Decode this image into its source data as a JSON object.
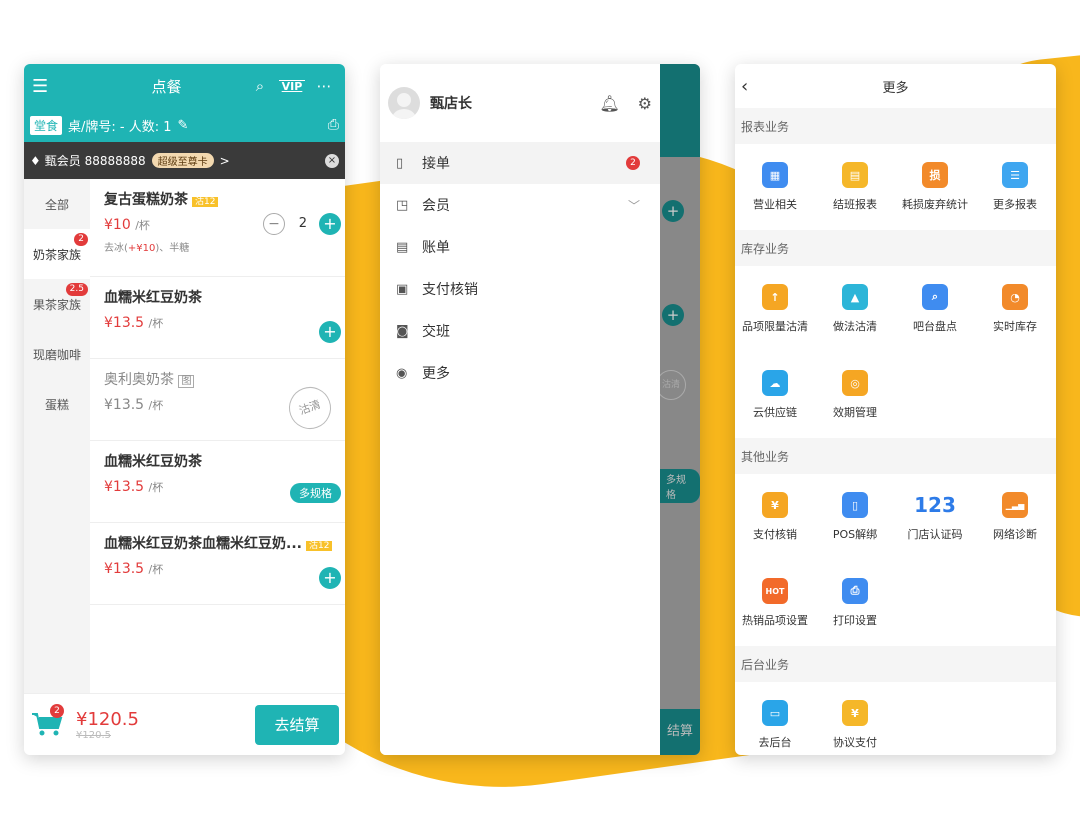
{
  "colors": {
    "teal": "#1fb4b4",
    "red": "#e23b3b",
    "yellow": "#f8b71c"
  },
  "ordering": {
    "header": {
      "menu_icon": "menu-icon",
      "title": "点餐",
      "search_icon": "search-icon",
      "vip_label": "VIP",
      "more_icon": "more-icon"
    },
    "sub": {
      "mode_tag": "堂食",
      "table_info": "桌/牌号: - 人数: 1",
      "edit_icon": "edit-icon",
      "print_icon": "print-icon"
    },
    "member": {
      "text": "甄会员 88888888",
      "card": "超级至尊卡",
      "chevron": ">",
      "close": "×"
    },
    "categories": [
      {
        "label": "全部",
        "badge": ""
      },
      {
        "label": "奶茶家族",
        "badge": "2"
      },
      {
        "label": "果茶家族",
        "badge": "2.5"
      },
      {
        "label": "现磨咖啡",
        "badge": ""
      },
      {
        "label": "蛋糕",
        "badge": ""
      }
    ],
    "items": [
      {
        "name": "复古蛋糕奶茶",
        "tag": "沽12",
        "price": "¥10",
        "unit": "/杯",
        "note_a": "去冰(",
        "note_red": "+¥10",
        "note_b": ")、半糖",
        "qty": "2"
      },
      {
        "name": "血糯米红豆奶茶",
        "price": "¥13.5",
        "unit": "/杯"
      },
      {
        "name": "奥利奥奶茶",
        "badge": "图",
        "price": "¥13.5",
        "unit": "/杯",
        "stamp": "沽清"
      },
      {
        "name": "血糯米红豆奶茶",
        "price": "¥13.5",
        "unit": "/杯",
        "spec": "多规格"
      },
      {
        "name": "血糯米红豆奶茶血糯米红豆奶...",
        "tag": "沽12",
        "price": "¥13.5",
        "unit": "/杯"
      }
    ],
    "footer": {
      "cart_badge": "2",
      "total": "¥120.5",
      "original": "¥120.5",
      "checkout": "去结算"
    }
  },
  "drawer": {
    "user_name": "甄店长",
    "items": [
      {
        "icon": "phone-icon",
        "glyph": "▯",
        "label": "接单",
        "badge": "2"
      },
      {
        "icon": "member-icon",
        "glyph": "◳",
        "label": "会员",
        "chevron": "﹀"
      },
      {
        "icon": "bill-icon",
        "glyph": "▤",
        "label": "账单"
      },
      {
        "icon": "payment-icon",
        "glyph": "▣",
        "label": "支付核销"
      },
      {
        "icon": "shift-icon",
        "glyph": "◙",
        "label": "交班"
      },
      {
        "icon": "more-circle-icon",
        "glyph": "◉",
        "label": "更多"
      }
    ],
    "behind": {
      "stamp": "沽清",
      "spec": "多规格",
      "checkout": "结算"
    }
  },
  "more": {
    "title": "更多",
    "sections": [
      {
        "title": "报表业务",
        "items": [
          {
            "label": "营业相关",
            "icon": "store-icon",
            "color": "#3f8cf0",
            "glyph": "▦"
          },
          {
            "label": "结班报表",
            "icon": "report-icon",
            "color": "#f5b729",
            "glyph": "▤"
          },
          {
            "label": "耗损废弃统计",
            "icon": "waste-icon",
            "color": "#f28a2a",
            "glyph": "损"
          },
          {
            "label": "更多报表",
            "icon": "more-report-icon",
            "color": "#3fa6f0",
            "glyph": "☰"
          }
        ]
      },
      {
        "title": "库存业务",
        "items": [
          {
            "label": "品项限量沽清",
            "icon": "limit-icon",
            "color": "#f5a623",
            "glyph": "↑"
          },
          {
            "label": "做法沽清",
            "icon": "method-icon",
            "color": "#2cb5d8",
            "glyph": "▲"
          },
          {
            "label": "吧台盘点",
            "icon": "inventory-icon",
            "color": "#3f8cf0",
            "glyph": "⌕"
          },
          {
            "label": "实时库存",
            "icon": "stock-icon",
            "color": "#f28a2a",
            "glyph": "◔"
          },
          {
            "label": "云供应链",
            "icon": "cloud-icon",
            "color": "#2aa5e8",
            "glyph": "☁"
          },
          {
            "label": "效期管理",
            "icon": "expiry-icon",
            "color": "#f5a623",
            "glyph": "◎"
          }
        ]
      },
      {
        "title": "其他业务",
        "items": [
          {
            "label": "支付核销",
            "icon": "pay-icon",
            "color": "#f5a623",
            "glyph": "¥"
          },
          {
            "label": "POS解绑",
            "icon": "pos-icon",
            "color": "#3f8cf0",
            "glyph": "▯"
          },
          {
            "label": "门店认证码",
            "icon": "code-icon",
            "color": "#2d7be8",
            "glyph": "123"
          },
          {
            "label": "网络诊断",
            "icon": "signal-icon",
            "color": "#f28a2a",
            "glyph": "▁▃▅"
          },
          {
            "label": "热销品项设置",
            "icon": "hot-icon",
            "color": "#f26a2a",
            "glyph": "HOT"
          },
          {
            "label": "打印设置",
            "icon": "printer-icon",
            "color": "#3f8cf0",
            "glyph": "⎙"
          }
        ]
      },
      {
        "title": "后台业务",
        "items": [
          {
            "label": "去后台",
            "icon": "backend-icon",
            "color": "#2aa5e8",
            "glyph": "▭"
          },
          {
            "label": "协议支付",
            "icon": "agreement-pay-icon",
            "color": "#f5b729",
            "glyph": "¥"
          }
        ]
      }
    ]
  }
}
